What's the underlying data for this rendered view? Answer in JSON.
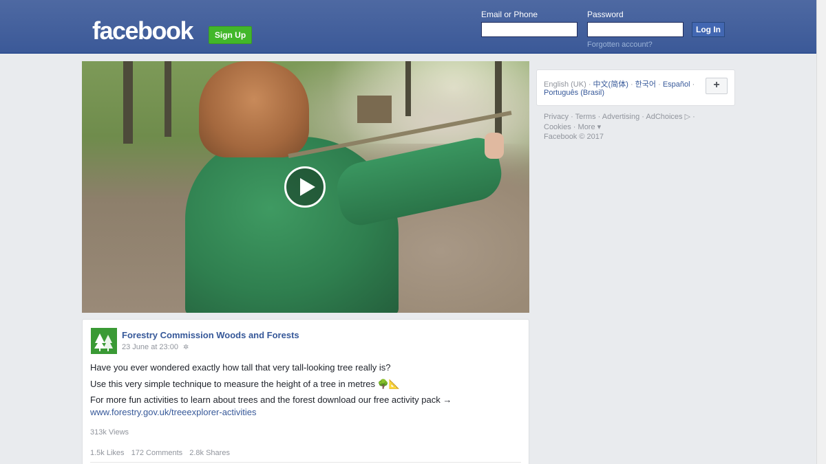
{
  "header": {
    "logo": "facebook",
    "signup_label": "Sign Up",
    "email_label": "Email or Phone",
    "password_label": "Password",
    "login_label": "Log In",
    "forgot_label": "Forgotten account?",
    "email_value": "",
    "password_value": ""
  },
  "video": {
    "play_icon": "play-icon"
  },
  "post": {
    "page_name": "Forestry Commission Woods and Forests",
    "timestamp": "23 June at 23:00",
    "privacy_icon": "globe-icon",
    "lines": [
      "Have you ever wondered exactly how tall that very tall-looking tree really is?",
      "Use this very simple technique to measure the height of a tree in metres 🌳📐",
      "For more fun activities to learn about trees and the forest download our free activity pack →"
    ],
    "link": "www.forestry.gov.uk/treeexplorer-activities",
    "views": "313k Views",
    "likes": "1.5k Likes",
    "comments": "172 Comments",
    "shares": "2.8k Shares"
  },
  "languages": {
    "current": "English (UK)",
    "items": [
      "中文(简体)",
      "한국어",
      "Español",
      "Português (Brasil)"
    ],
    "more_button": "+"
  },
  "footer": {
    "privacy": "Privacy",
    "terms": "Terms",
    "advertising": "Advertising",
    "adchoices": "AdChoices",
    "cookies": "Cookies",
    "more": "More",
    "copyright": "Facebook © 2017"
  },
  "colors": {
    "brand_blue": "#3b5998",
    "signup_green": "#42b72a",
    "link_blue": "#365899"
  }
}
